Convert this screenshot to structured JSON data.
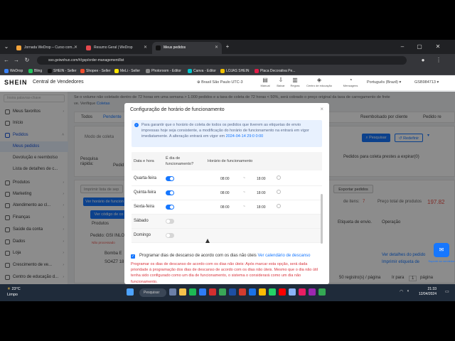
{
  "browser": {
    "tabs": [
      {
        "title": "Jornada WeDrop – Curso com..."
      },
      {
        "title": "Resumo Geral | WeDrop"
      },
      {
        "title": "Meus pedidos"
      }
    ],
    "new_tab": "+",
    "address": "sso.geiwohuo.com/#/gsp/order-management/list",
    "bookmarks": [
      "WeDrop",
      "Bling",
      "SHEIN - Seller",
      "Shopee - Seller",
      "MeLi - Seller",
      "Photoroom - Editor",
      "Canva - Editor",
      "LOJAS SHEIN",
      "Placa Decorativa Pe..."
    ]
  },
  "header": {
    "logo": "SHEIN",
    "title": "Central de Vendedores",
    "timezone": "Brasil São Paulo UTC-3",
    "icons": [
      "Manual",
      "Baixar",
      "Regras",
      "Centro de educação",
      "Mensagens"
    ],
    "language": "Português (Brazil)",
    "account": "GSB984713"
  },
  "sidebar": {
    "search_placeholder": "Insira palavras-chave",
    "items": [
      {
        "label": "Meus favoritos",
        "type": "group"
      },
      {
        "label": "Início",
        "type": "group"
      },
      {
        "label": "Pedidos",
        "type": "head"
      },
      {
        "label": "Meus pedidos",
        "type": "active"
      },
      {
        "label": "Devolução e reembolso",
        "type": "sub"
      },
      {
        "label": "Lista de detalhes de c...",
        "type": "sub"
      },
      {
        "label": "Produtos",
        "type": "group"
      },
      {
        "label": "Marketing",
        "type": "group"
      },
      {
        "label": "Atendimento ao cl...",
        "type": "group"
      },
      {
        "label": "Finanças",
        "type": "group"
      },
      {
        "label": "Saúde da conta",
        "type": "group"
      },
      {
        "label": "Dados",
        "type": "group"
      },
      {
        "label": "Loja",
        "type": "group"
      },
      {
        "label": "Crescimento de ve...",
        "type": "group"
      },
      {
        "label": "Centro de educação d...",
        "type": "group"
      }
    ]
  },
  "background": {
    "notice_line1": "Se o volume não coletado dentro de 72 horas em uma semana > 1.000 pedidos e a taxa de coleta de 72 horas < 50%, será cobrado o preço original da taxa de carregamento de frete",
    "notice_line2": "ve. Verifique",
    "notice_link": "Coletas",
    "tabs": [
      "Todos",
      "Pendente",
      "Reembolsado por cliente",
      "Pedido re"
    ],
    "tipo_coleta": "Modo de coleta",
    "pesquisa_rapida": "Pesquisa rápida:",
    "pedido": "Pedid",
    "search_btn": "Pesquisar",
    "reset_btn": "Redefinir",
    "filter_expire": "Pedidos para coleta prestes a expirar(0)",
    "import_label": "Imprimir lista de sep",
    "export_btn": "Exportar pedidos",
    "ver_horario": "Ver horário de funcion",
    "ver_codigo": "Ver código de co",
    "items_label": "de itens:",
    "items_count": "7",
    "total_label": "Preço total de produtos",
    "total_value": "197.82",
    "col_produtos": "Produtos",
    "col_etiqueta": "Etiqueta de envio.",
    "col_operacao": "Operação",
    "order_label": "Pedido: GSI INLO",
    "order_status": "Não processado",
    "product_name": "Bomba E",
    "sku": "SO4Z7 18",
    "ver_detalhes": "Ver detalhes do pedido",
    "imprimir_etiqueta": "Imprimir etiqueta de",
    "pagination": "50 registro(s) / página",
    "ir_para": "Ir para",
    "page": "1",
    "pagina": "página"
  },
  "modal": {
    "title": "Configuração de horário de funcionamento",
    "info": "Para garantir que o horário de coleta de todos os pedidos que tiverem as etiquetas de envio impressas hoje seja consistente, a modificação do horário de funcionamento na entrará em vigor imediatamente. A alteração entrará em vigor em",
    "info_date": "2024-04-14 29:0",
    "info_tail": "0:00",
    "col_day": "Data e hora",
    "col_workday": "É dia de funcionamento?",
    "col_hours": "Horário de funcionamento",
    "rows": [
      {
        "day": "Quarta-feira",
        "on": true,
        "from": "08:00",
        "to": "18:00"
      },
      {
        "day": "Quinta-feira",
        "on": true,
        "from": "08:00",
        "to": "18:00"
      },
      {
        "day": "Sexta-feira",
        "on": true,
        "from": "08:00",
        "to": "18:00"
      },
      {
        "day": "Sábado",
        "on": false,
        "from": "",
        "to": ""
      },
      {
        "day": "Domingo",
        "on": false,
        "from": "",
        "to": ""
      }
    ],
    "sep": "~",
    "check_label": "Programar dias de descanso de acordo com os dias não úteis",
    "check_link": "Ver calendário de descanso",
    "warning": "Programar os dias de descanso de acordo com os dias não úteis: Após marcar esta opção, será dada prioridade à programação dos dias de descanso de acordo com os dias não úteis. Mesmo que o dia não útil tenha sido configurado como um dia de funcionamento, o sistema o considerará como um dia não funcionamento."
  },
  "float": {
    "label": "Suporte ao vendedor"
  },
  "taskbar": {
    "temp": "23°C",
    "weather": "Limpo",
    "search": "Pesquisar",
    "time": "21:33",
    "date": "12/04/2024"
  },
  "colors": {
    "accent": "#1677ff",
    "warning": "#d9363e",
    "price": "#e8524a"
  }
}
